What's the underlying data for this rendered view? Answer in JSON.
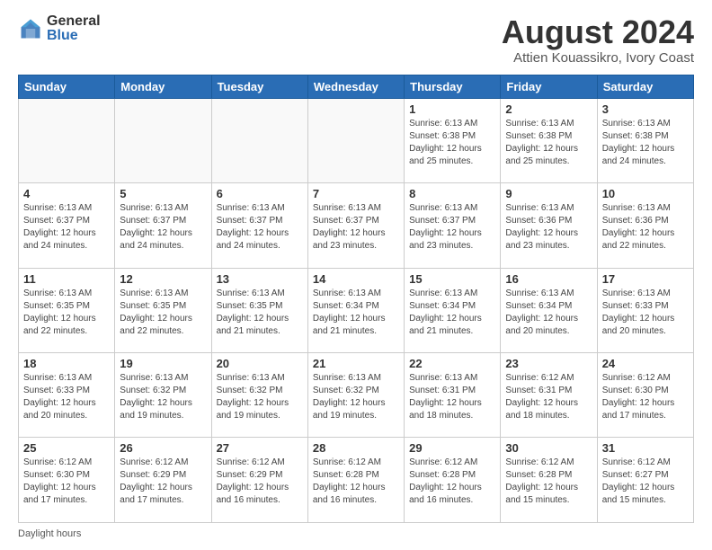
{
  "logo": {
    "general": "General",
    "blue": "Blue"
  },
  "title": "August 2024",
  "subtitle": "Attien Kouassikro, Ivory Coast",
  "days_of_week": [
    "Sunday",
    "Monday",
    "Tuesday",
    "Wednesday",
    "Thursday",
    "Friday",
    "Saturday"
  ],
  "footer": "Daylight hours",
  "weeks": [
    [
      {
        "day": "",
        "info": ""
      },
      {
        "day": "",
        "info": ""
      },
      {
        "day": "",
        "info": ""
      },
      {
        "day": "",
        "info": ""
      },
      {
        "day": "1",
        "info": "Sunrise: 6:13 AM\nSunset: 6:38 PM\nDaylight: 12 hours\nand 25 minutes."
      },
      {
        "day": "2",
        "info": "Sunrise: 6:13 AM\nSunset: 6:38 PM\nDaylight: 12 hours\nand 25 minutes."
      },
      {
        "day": "3",
        "info": "Sunrise: 6:13 AM\nSunset: 6:38 PM\nDaylight: 12 hours\nand 24 minutes."
      }
    ],
    [
      {
        "day": "4",
        "info": "Sunrise: 6:13 AM\nSunset: 6:37 PM\nDaylight: 12 hours\nand 24 minutes."
      },
      {
        "day": "5",
        "info": "Sunrise: 6:13 AM\nSunset: 6:37 PM\nDaylight: 12 hours\nand 24 minutes."
      },
      {
        "day": "6",
        "info": "Sunrise: 6:13 AM\nSunset: 6:37 PM\nDaylight: 12 hours\nand 24 minutes."
      },
      {
        "day": "7",
        "info": "Sunrise: 6:13 AM\nSunset: 6:37 PM\nDaylight: 12 hours\nand 23 minutes."
      },
      {
        "day": "8",
        "info": "Sunrise: 6:13 AM\nSunset: 6:37 PM\nDaylight: 12 hours\nand 23 minutes."
      },
      {
        "day": "9",
        "info": "Sunrise: 6:13 AM\nSunset: 6:36 PM\nDaylight: 12 hours\nand 23 minutes."
      },
      {
        "day": "10",
        "info": "Sunrise: 6:13 AM\nSunset: 6:36 PM\nDaylight: 12 hours\nand 22 minutes."
      }
    ],
    [
      {
        "day": "11",
        "info": "Sunrise: 6:13 AM\nSunset: 6:35 PM\nDaylight: 12 hours\nand 22 minutes."
      },
      {
        "day": "12",
        "info": "Sunrise: 6:13 AM\nSunset: 6:35 PM\nDaylight: 12 hours\nand 22 minutes."
      },
      {
        "day": "13",
        "info": "Sunrise: 6:13 AM\nSunset: 6:35 PM\nDaylight: 12 hours\nand 21 minutes."
      },
      {
        "day": "14",
        "info": "Sunrise: 6:13 AM\nSunset: 6:34 PM\nDaylight: 12 hours\nand 21 minutes."
      },
      {
        "day": "15",
        "info": "Sunrise: 6:13 AM\nSunset: 6:34 PM\nDaylight: 12 hours\nand 21 minutes."
      },
      {
        "day": "16",
        "info": "Sunrise: 6:13 AM\nSunset: 6:34 PM\nDaylight: 12 hours\nand 20 minutes."
      },
      {
        "day": "17",
        "info": "Sunrise: 6:13 AM\nSunset: 6:33 PM\nDaylight: 12 hours\nand 20 minutes."
      }
    ],
    [
      {
        "day": "18",
        "info": "Sunrise: 6:13 AM\nSunset: 6:33 PM\nDaylight: 12 hours\nand 20 minutes."
      },
      {
        "day": "19",
        "info": "Sunrise: 6:13 AM\nSunset: 6:32 PM\nDaylight: 12 hours\nand 19 minutes."
      },
      {
        "day": "20",
        "info": "Sunrise: 6:13 AM\nSunset: 6:32 PM\nDaylight: 12 hours\nand 19 minutes."
      },
      {
        "day": "21",
        "info": "Sunrise: 6:13 AM\nSunset: 6:32 PM\nDaylight: 12 hours\nand 19 minutes."
      },
      {
        "day": "22",
        "info": "Sunrise: 6:13 AM\nSunset: 6:31 PM\nDaylight: 12 hours\nand 18 minutes."
      },
      {
        "day": "23",
        "info": "Sunrise: 6:12 AM\nSunset: 6:31 PM\nDaylight: 12 hours\nand 18 minutes."
      },
      {
        "day": "24",
        "info": "Sunrise: 6:12 AM\nSunset: 6:30 PM\nDaylight: 12 hours\nand 17 minutes."
      }
    ],
    [
      {
        "day": "25",
        "info": "Sunrise: 6:12 AM\nSunset: 6:30 PM\nDaylight: 12 hours\nand 17 minutes."
      },
      {
        "day": "26",
        "info": "Sunrise: 6:12 AM\nSunset: 6:29 PM\nDaylight: 12 hours\nand 17 minutes."
      },
      {
        "day": "27",
        "info": "Sunrise: 6:12 AM\nSunset: 6:29 PM\nDaylight: 12 hours\nand 16 minutes."
      },
      {
        "day": "28",
        "info": "Sunrise: 6:12 AM\nSunset: 6:28 PM\nDaylight: 12 hours\nand 16 minutes."
      },
      {
        "day": "29",
        "info": "Sunrise: 6:12 AM\nSunset: 6:28 PM\nDaylight: 12 hours\nand 16 minutes."
      },
      {
        "day": "30",
        "info": "Sunrise: 6:12 AM\nSunset: 6:28 PM\nDaylight: 12 hours\nand 15 minutes."
      },
      {
        "day": "31",
        "info": "Sunrise: 6:12 AM\nSunset: 6:27 PM\nDaylight: 12 hours\nand 15 minutes."
      }
    ]
  ]
}
